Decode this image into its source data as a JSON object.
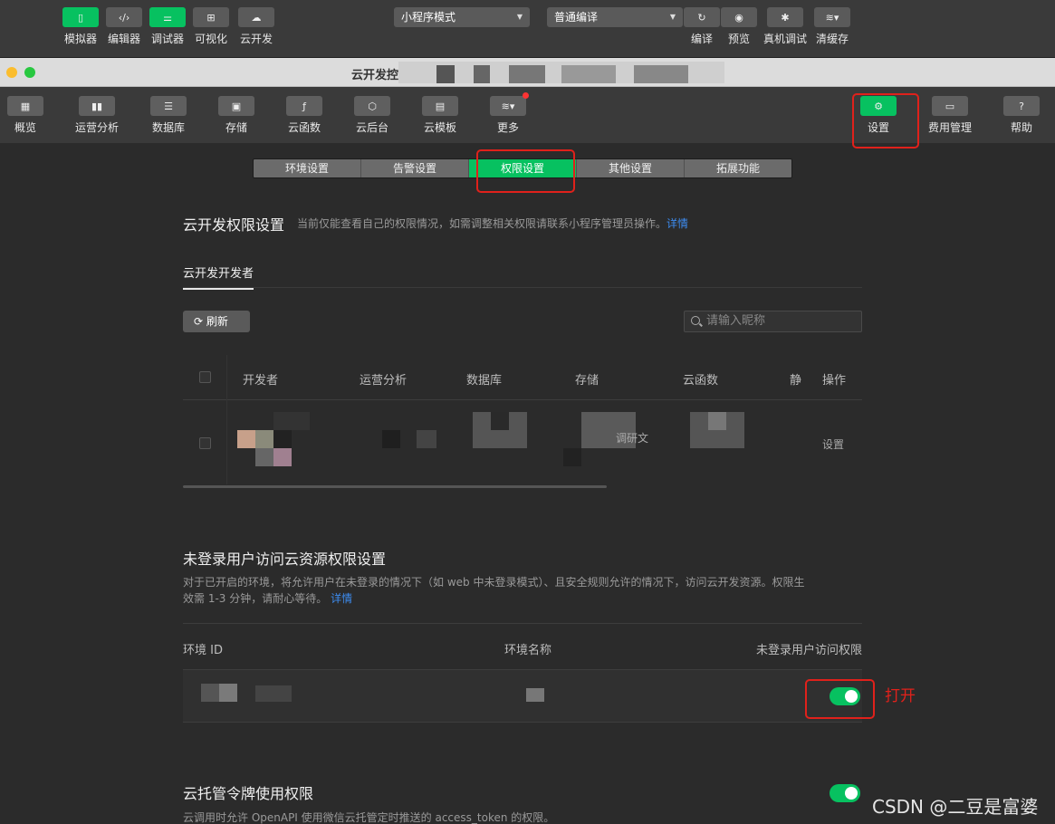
{
  "ide_toolbar": {
    "left_buttons": [
      {
        "label": "模拟器",
        "icon": "phone-icon"
      },
      {
        "label": "编辑器",
        "icon": "code-icon"
      },
      {
        "label": "调试器",
        "icon": "sliders-icon"
      },
      {
        "label": "可视化",
        "icon": "layout-icon"
      },
      {
        "label": "云开发",
        "icon": "cloud-icon"
      }
    ],
    "mode_select": "小程序模式",
    "compile_select": "普通编译",
    "right_buttons": [
      {
        "label": "编译",
        "icon": "refresh-icon"
      },
      {
        "label": "预览",
        "icon": "eye-icon"
      },
      {
        "label": "真机调试",
        "icon": "bug-icon"
      },
      {
        "label": "清缓存",
        "icon": "layers-icon"
      }
    ]
  },
  "window": {
    "title": "云开发控制台"
  },
  "console_nav": {
    "items": [
      {
        "label": "概览",
        "icon": "grid-icon"
      },
      {
        "label": "运营分析",
        "icon": "bar-chart-icon"
      },
      {
        "label": "数据库",
        "icon": "database-icon"
      },
      {
        "label": "存储",
        "icon": "save-icon"
      },
      {
        "label": "云函数",
        "icon": "function-icon"
      },
      {
        "label": "云后台",
        "icon": "cube-icon"
      },
      {
        "label": "云模板",
        "icon": "template-icon"
      },
      {
        "label": "更多",
        "icon": "layers-icon"
      }
    ],
    "right_items": [
      {
        "label": "设置",
        "icon": "gear-icon"
      },
      {
        "label": "费用管理",
        "icon": "billing-icon"
      },
      {
        "label": "帮助",
        "icon": "help-icon"
      }
    ]
  },
  "settings_tabs": [
    "环境设置",
    "告警设置",
    "权限设置",
    "其他设置",
    "拓展功能"
  ],
  "permissions": {
    "title": "云开发权限设置",
    "desc": "当前仅能查看自己的权限情况，如需调整相关权限请联系小程序管理员操作。",
    "desc_link": "详情",
    "sub_tab": "云开发开发者",
    "refresh_label": "刷新",
    "search_placeholder": "请输入昵称",
    "columns": [
      "开发者",
      "运营分析",
      "数据库",
      "存储",
      "云函数",
      "静",
      "操作"
    ],
    "row_cells": [
      "调研文",
      "设置"
    ]
  },
  "unauth": {
    "title": "未登录用户访问云资源权限设置",
    "desc_line1": "对于已开启的环境，将允许用户在未登录的情况下（如 web 中未登录模式）、且安全规则允许的情况下，访问云开发资源。权限生",
    "desc_line2": "效需 1-3 分钟，请耐心等待。",
    "desc_link": "详情",
    "columns": [
      "环境 ID",
      "环境名称",
      "未登录用户访问权限"
    ],
    "toggle_on": true
  },
  "token": {
    "title": "云托管令牌使用权限",
    "desc": "云调用时允许 OpenAPI 使用微信云托管定时推送的 access_token 的权限。",
    "toggle_on": true
  },
  "annotation": "打开",
  "watermark": "CSDN @二豆是富婆",
  "colors": {
    "accent": "#07c160",
    "highlight": "#e0211b",
    "link": "#3d8cf0"
  }
}
